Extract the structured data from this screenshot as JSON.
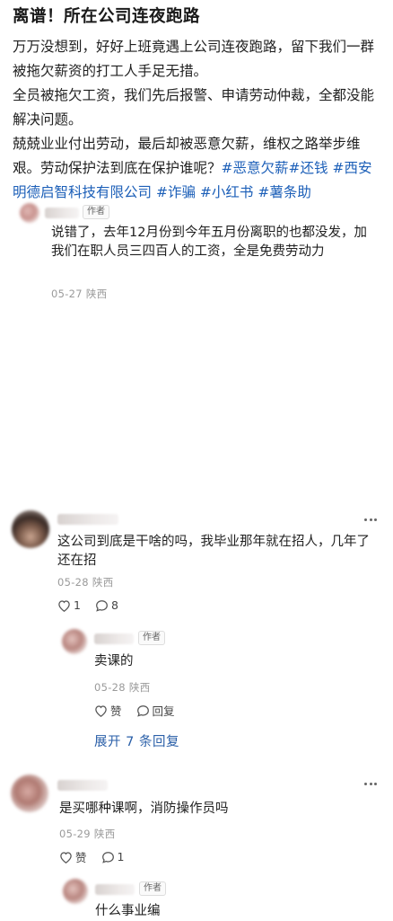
{
  "post": {
    "title": "离谱！所在公司连夜跑路",
    "paragraphs": [
      "万万没想到，好好上班竟遇上公司连夜跑路，留下我们一群被拖欠薪资的打工人手足无措。",
      "全员被拖欠工资，我们先后报警、申请劳动仲裁，全都没能解决问题。"
    ],
    "last_paragraph": {
      "text": "兢兢业业付出劳动，最后却被恶意欠薪，维权之路举步维艰。劳动保护法到底在保护谁呢？",
      "tags": [
        "#恶意欠薪",
        "#还钱",
        "#西安明德启智科技有限公司",
        "#诈骗",
        "#小红书",
        "#薯条助"
      ]
    }
  },
  "comments": [
    {
      "author_tag": "作者",
      "text": "说错了，去年12月份到今年五月份离职的也都没发，加我们在职人员三四百人的工资，全是免费劳动力",
      "date": "05-27",
      "location": "陕西"
    },
    {
      "text": "这公司到底是干啥的吗，我毕业那年就在招人，几年了还在招",
      "date": "05-28",
      "location": "陕西",
      "likes": "1",
      "replies": "8",
      "more_icon": "more-dots-icon"
    },
    {
      "author_tag": "作者",
      "text": "卖课的",
      "date": "05-28",
      "location": "陕西",
      "like_label": "赞",
      "reply_label": "回复",
      "expand_label": "展开 7 条回复"
    },
    {
      "text": "是买哪种课啊，消防操作员吗",
      "date": "05-29",
      "location": "陕西",
      "like_label": "赞",
      "replies": "1",
      "more_icon": "more-dots-icon"
    },
    {
      "author_tag": "作者",
      "text": "什么事业编"
    }
  ],
  "colors": {
    "tag": "#1c5fb8",
    "link": "#2a5fa8",
    "meta": "#9a9a9a"
  }
}
